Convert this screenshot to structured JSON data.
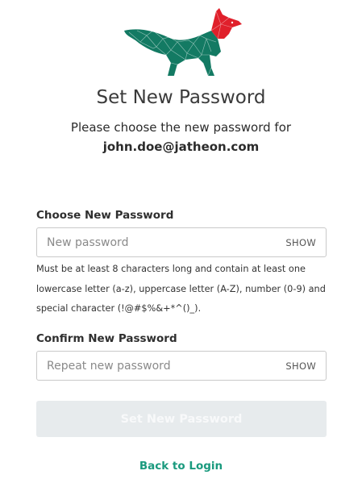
{
  "brand": {
    "logo_icon": "fox-logo-icon",
    "body_color": "#137a63",
    "head_color": "#e0202b"
  },
  "header": {
    "title": "Set New Password",
    "subtitle": "Please choose the new password for",
    "email": "john.doe@jatheon.com"
  },
  "new_password": {
    "label": "Choose New Password",
    "placeholder": "New password",
    "value": "",
    "toggle_label": "SHOW"
  },
  "requirements": {
    "lines": [
      "Must be at least 8 characters long and contain at least one",
      "lowercase letter (a-z), uppercase letter (A-Z), number (0-9) and",
      "special character (!@#$%&+*^()_)."
    ]
  },
  "confirm_password": {
    "label": "Confirm New Password",
    "placeholder": "Repeat new password",
    "value": "",
    "toggle_label": "SHOW"
  },
  "actions": {
    "submit_label": "Set New Password",
    "submit_state": "disabled",
    "back_label": "Back to Login"
  },
  "colors": {
    "accent": "#1a9a7e",
    "button_disabled_bg": "#e7ebed"
  }
}
